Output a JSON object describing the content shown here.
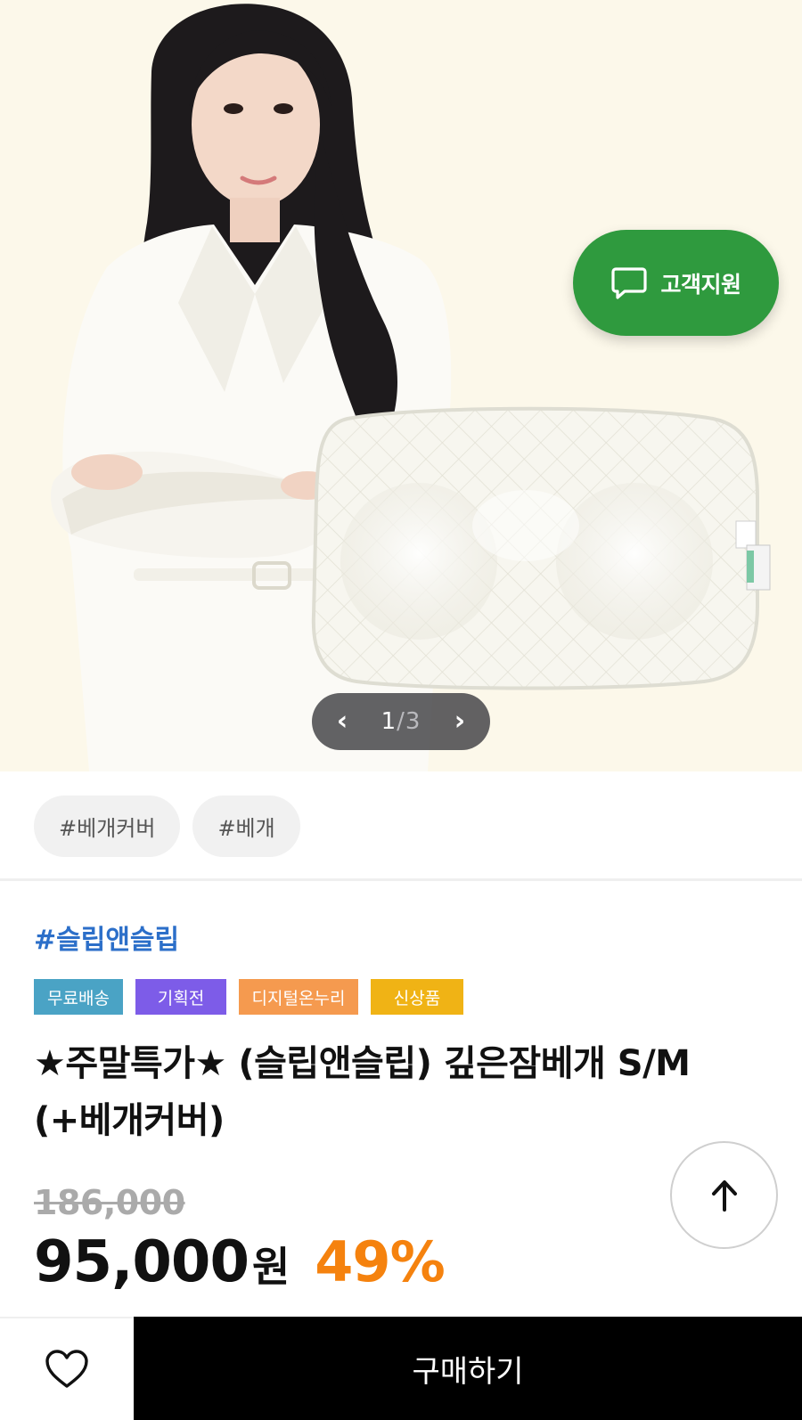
{
  "hero": {
    "support_label": "고객지원",
    "pager": {
      "current": "1",
      "separator": "/",
      "total": "3"
    }
  },
  "tags": [
    "#베개커버",
    "#베개"
  ],
  "product": {
    "brand": "#슬립앤슬립",
    "badges": [
      "무료배송",
      "기획전",
      "디지털온누리",
      "신상품"
    ],
    "title": "★주말특가★ (슬립앤슬립) 깊은잠베개 S/M (+베개커버)",
    "original_price": "186,000",
    "price": "95,000",
    "price_unit": "원",
    "discount": "49%"
  },
  "bottom_bar": {
    "buy_label": "구매하기"
  },
  "colors": {
    "support_green": "#2f9a3e",
    "brand_blue": "#2c6fc9",
    "discount_orange": "#f5820e",
    "badge_free_shipping": "#4aa3c5",
    "badge_event": "#7d5ce8",
    "badge_onnuri": "#f59a4f",
    "badge_new": "#f0b315"
  },
  "icons": {
    "support": "chat-bubble-icon",
    "prev": "chevron-left-icon",
    "next": "chevron-right-icon",
    "scroll_top": "arrow-up-icon",
    "wishlist": "heart-icon"
  }
}
